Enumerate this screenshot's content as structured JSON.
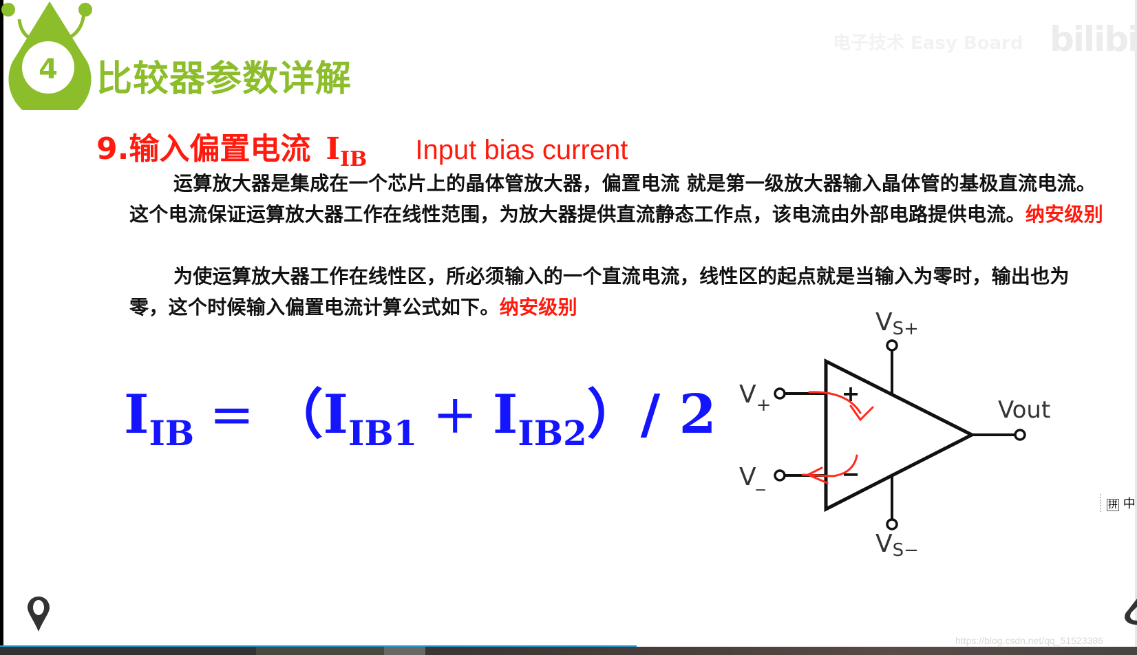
{
  "slide": {
    "section_number": "4",
    "section_title": "比较器参数详解",
    "watermark_text": "电子技术 Easy Board",
    "platform_logo": "bilibili",
    "heading": {
      "number_and_title": "9.输入偏置电流",
      "symbol_main": "I",
      "symbol_sub": "IB",
      "english": "Input bias current"
    },
    "paragraph1": {
      "text": "运算放大器是集成在一个芯片上的晶体管放大器，偏置电流 就是第一级放大器输入晶体管的基极直流电流。这个电流保证运算放大器工作在线性范围，为放大器提供直流静态工作点，该电流由外部电路提供电流。",
      "highlight": "纳安级别"
    },
    "paragraph2": {
      "text": "为使运算放大器工作在线性区，所必须输入的一个直流电流，线性区的起点就是当输入为零时，输出也为零，这个时候输入偏置电流计算公式如下。",
      "highlight": "纳安级别"
    },
    "formula": {
      "lhs_main": "I",
      "lhs_sub": "IB",
      "equals": "=",
      "open_paren": "（",
      "term1_main": "I",
      "term1_sub": "IB1",
      "plus": "+",
      "term2_main": "I",
      "term2_sub": "IB2",
      "close_paren": "）/ 2"
    },
    "opamp_diagram": {
      "supply_pos_label": "V",
      "supply_pos_sub": "S+",
      "supply_neg_label": "V",
      "supply_neg_sub": "S−",
      "input_pos_label": "V",
      "input_pos_sub": "+",
      "input_neg_label": "V",
      "input_neg_sub": "_",
      "output_label": "Vout",
      "plus_sign": "+",
      "minus_sign": "−",
      "annotation_color": "#ff2a1a"
    }
  },
  "ime_indicator": {
    "mode_box": "拼",
    "language": "中"
  },
  "url_watermark": "https://blog.csdn.net/qq_51523386",
  "colors": {
    "section_green": "#8cbd2a",
    "heading_red": "#ff1a0d",
    "formula_blue": "#1414ff",
    "progress_blue": "#19a0d8"
  }
}
